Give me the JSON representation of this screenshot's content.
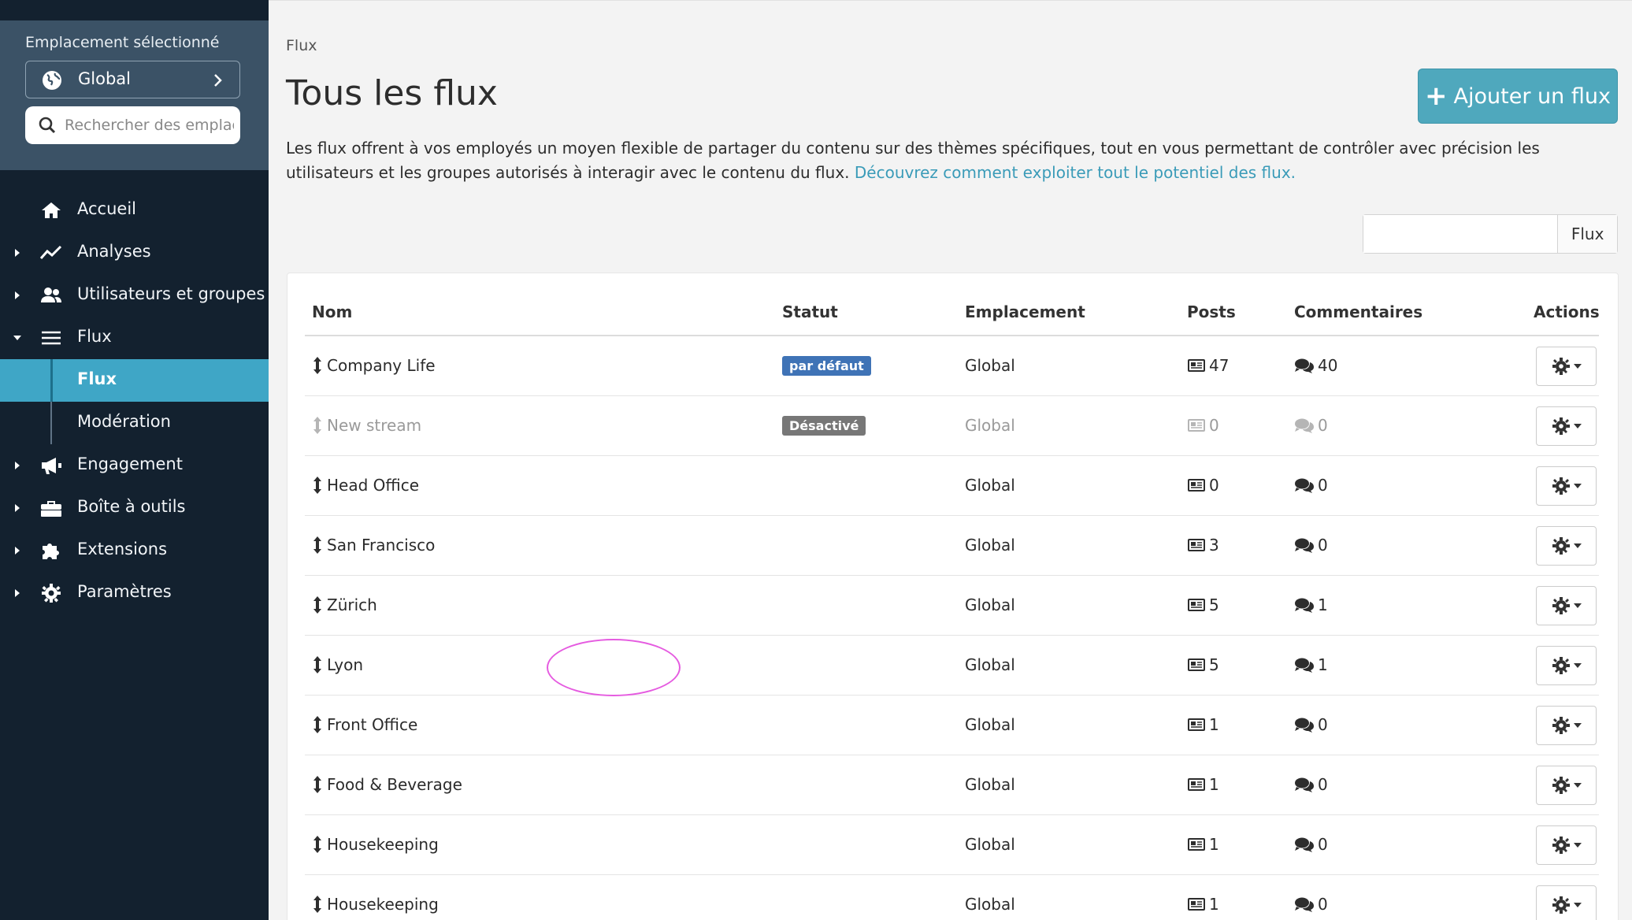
{
  "sidebar": {
    "location_label": "Emplacement sélectionné",
    "location_value": "Global",
    "search_placeholder": "Rechercher des emplacements",
    "items": [
      {
        "label": "Accueil"
      },
      {
        "label": "Analyses"
      },
      {
        "label": "Utilisateurs et groupes"
      },
      {
        "label": "Flux"
      },
      {
        "label": "Flux"
      },
      {
        "label": "Modération"
      },
      {
        "label": "Engagement"
      },
      {
        "label": "Boîte à outils"
      },
      {
        "label": "Extensions"
      },
      {
        "label": "Paramètres"
      }
    ]
  },
  "header": {
    "breadcrumb": "Flux",
    "title": "Tous les flux",
    "add_button": "Ajouter un flux",
    "description": "Les flux offrent à vos employés un moyen flexible de partager du contenu sur des thèmes spécifiques, tout en vous permettant de contrôler avec précision les utilisateurs et les groupes autorisés à interagir avec le contenu du flux.",
    "learn_more": "Découvrez comment exploiter tout le potentiel des flux."
  },
  "filter": {
    "value": "",
    "button": "Flux"
  },
  "table": {
    "columns": [
      "Nom",
      "Statut",
      "Emplacement",
      "Posts",
      "Commentaires",
      "Actions"
    ],
    "rows": [
      {
        "name": "Company Life",
        "status": "par défaut",
        "location": "Global",
        "posts": "47",
        "comments": "40"
      },
      {
        "name": "New stream",
        "status": "Désactivé",
        "location": "Global",
        "posts": "0",
        "comments": "0"
      },
      {
        "name": "Head Office",
        "status": "",
        "location": "Global",
        "posts": "0",
        "comments": "0"
      },
      {
        "name": "San Francisco",
        "status": "",
        "location": "Global",
        "posts": "3",
        "comments": "0"
      },
      {
        "name": "Zürich",
        "status": "",
        "location": "Global",
        "posts": "5",
        "comments": "1"
      },
      {
        "name": "Lyon",
        "status": "",
        "location": "Global",
        "posts": "5",
        "comments": "1"
      },
      {
        "name": "Front Office",
        "status": "",
        "location": "Global",
        "posts": "1",
        "comments": "0"
      },
      {
        "name": "Food & Beverage",
        "status": "",
        "location": "Global",
        "posts": "1",
        "comments": "0"
      },
      {
        "name": "Housekeeping",
        "status": "",
        "location": "Global",
        "posts": "1",
        "comments": "0"
      },
      {
        "name": "Housekeeping",
        "status": "",
        "location": "Global",
        "posts": "1",
        "comments": "0"
      }
    ]
  },
  "colors": {
    "sidebar_bg": "#13212f",
    "location_panel_bg": "#3b5266",
    "accent": "#3fa6c6",
    "badge_default": "#3f73b6",
    "badge_disabled": "#777777",
    "highlight": "#e55be0"
  }
}
